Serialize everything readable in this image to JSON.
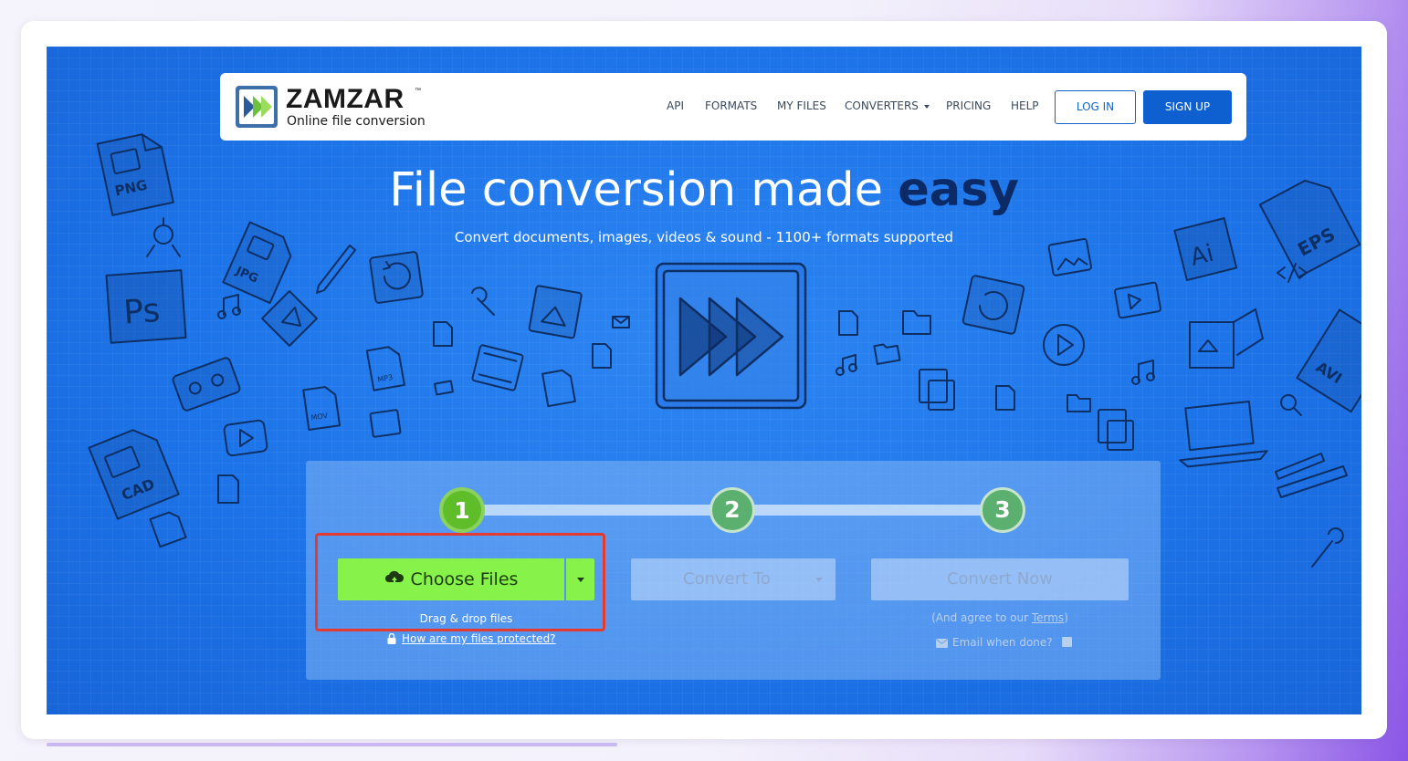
{
  "brand": {
    "name": "ZAMZAR",
    "trademark": "™",
    "tagline": "Online file conversion"
  },
  "nav": {
    "items": [
      "API",
      "FORMATS",
      "MY FILES",
      "CONVERTERS",
      "PRICING",
      "HELP"
    ],
    "login": "LOG IN",
    "signup": "SIGN UP"
  },
  "hero": {
    "title_plain": "File conversion made ",
    "title_emphasis": "easy",
    "subtitle": "Convert documents, images, videos & sound - 1100+ formats supported"
  },
  "converter": {
    "steps": [
      "1",
      "2",
      "3"
    ],
    "choose_files": "Choose Files",
    "drag_drop": "Drag & drop files",
    "protected_link": "How are my files protected?",
    "convert_to": "Convert To",
    "convert_now": "Convert Now",
    "agree_prefix": "(And agree to our ",
    "terms": "Terms",
    "agree_suffix": ")",
    "email_label": "Email when done?"
  },
  "doodle_labels": {
    "png": "PNG",
    "jpg": "JPG",
    "ps": "Ps",
    "cad": "CAD",
    "eps": "EPS",
    "ai": "Ai",
    "mp3": "MP3",
    "mov": "MOV",
    "avi": "AVI"
  },
  "colors": {
    "stage_blue": "#1d74e8",
    "choose_green": "#86f24a",
    "step_active": "#5fbd2a",
    "highlight_red": "#e53a2f",
    "signup_blue": "#0e5fd0",
    "easy_navy": "#0b2a66"
  }
}
